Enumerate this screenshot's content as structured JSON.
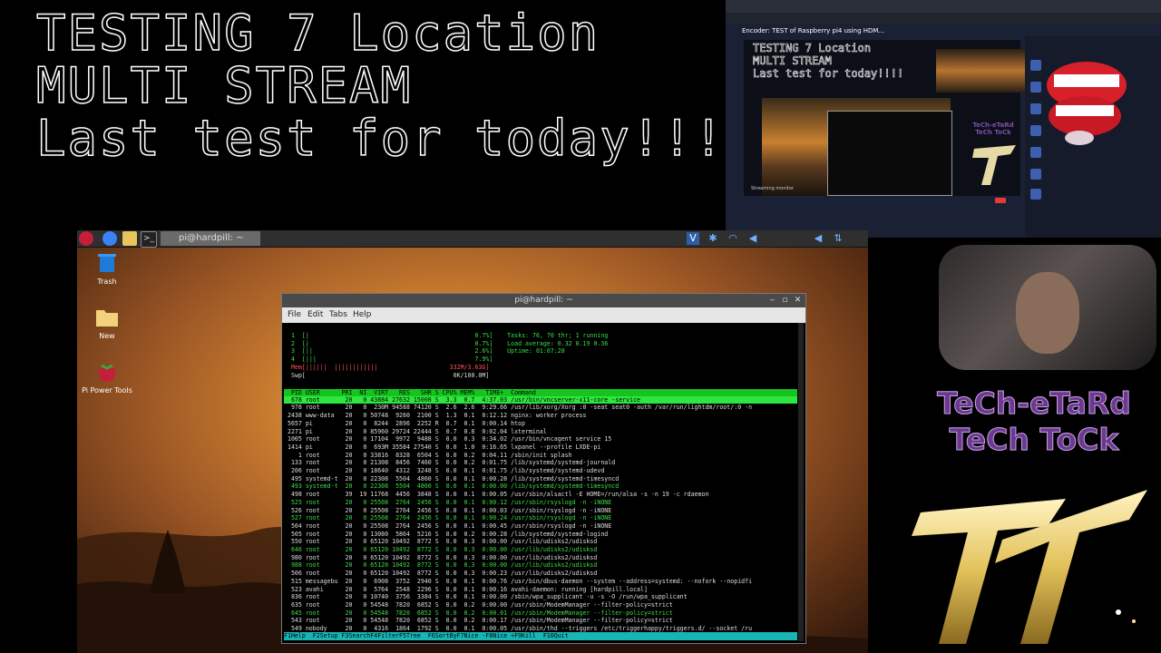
{
  "headline": {
    "line1": "TESTING 7 Location",
    "line2": "MULTI STREAM",
    "line3": "Last test for today!!!!"
  },
  "encoder": {
    "title": "Encoder: TEST of Raspberry pi4 using HDM...",
    "preview_text": "TESTING 7 Location\nMULTI STREAM\nLast test for today!!!!",
    "streaming_label": "Streaming monitor",
    "brand_small_1": "TeCh-eTaRd",
    "brand_small_2": "TeCh ToCk"
  },
  "taskbar": {
    "task_label": "pi@hardpill: ~"
  },
  "desktop_icons": [
    {
      "label": "Trash",
      "icon": "trash-icon"
    },
    {
      "label": "New",
      "icon": "folder-icon"
    },
    {
      "label": "Pi Power Tools",
      "icon": "raspberry-icon"
    }
  ],
  "terminal": {
    "title": "pi@hardpill: ~",
    "menu": [
      "File",
      "Edit",
      "Tabs",
      "Help"
    ],
    "cpu_lines": [
      "1  [|                                              0.7%]    Tasks: 76, 70 thr; 1 running",
      "2  [|                                              0.7%]    Load average: 0.32 0.19 0.36",
      "3  [||                                             2.6%]    Uptime: 01:07:28",
      "4  [|||                                            7.9%]",
      "Mem[||||||  ||||||||||||                    332M/3.63G]",
      "Swp[                                         0K/100.0M]"
    ],
    "proc_header": "  PID USER      PRI  NI  VIRT   RES   SHR S CPU% MEM%   TIME+  Command",
    "selected_row": "  678 root       20   0 43884 27632 15008 S  3.3  0.7  4:37.03 /usr/bin/vncserver-x11-core -service",
    "rows": [
      "  978 root       20   0  230M 94588 74120 S  2.6  2.6  9:29.66 /usr/lib/xorg/Xorg :0 -seat seat0 -auth /var/run/lightdm/root/:0 -n",
      " 2438 www-data   20   0 50748  9260  2100 S  1.3  0.1  0:12.12 nginx: worker process",
      " 5657 pi         20   0  8244  2896  2252 R  0.7  0.1  0:00.14 htop",
      " 2271 pi         20   0 85960 29724 22444 S  0.7  0.8  0:02.04 lxterminal",
      " 1005 root       20   0 17104  9972  9488 S  0.0  0.3  0:34.02 /usr/bin/vncagent service 15",
      " 1414 pi         20   0  693M 35584 27540 S  0.0  1.0  0:16.65 lxpanel --profile LXDE-pi",
      "    1 root       20   0 33816  8328  6504 S  0.0  0.2  0:04.11 /sbin/init splash",
      "  133 root       20   0 21308  8456  7460 S  0.0  0.2  0:01.75 /lib/systemd/systemd-journald",
      "  206 root       20   0 18640  4312  3248 S  0.0  0.1  0:01.75 /lib/systemd/systemd-udevd",
      "  495 systemd-t  20   0 22308  5504  4860 S  0.0  0.1  0:00.28 /lib/systemd/systemd-timesyncd",
      "  493 systemd-t  20   0 22308  5504  4860 S  0.0  0.1  0:00.00 /lib/systemd/systemd-timesyncd",
      "  498 root       39  19 11768  4456  3848 S  0.0  0.1  0:00.05 /usr/sbin/alsactl -E HOME=/run/alsa -s -n 19 -c rdaemon",
      "  525 root       20   0 25508  2764  2456 S  0.0  0.1  0:00.12 /usr/sbin/rsyslogd -n -iNONE",
      "  526 root       20   0 25508  2764  2456 S  0.0  0.1  0:00.03 /usr/sbin/rsyslogd -n -iNONE",
      "  527 root       20   0 25508  2764  2456 S  0.0  0.1  0:00.24 /usr/sbin/rsyslogd -n -iNONE",
      "  504 root       20   0 25508  2764  2456 S  0.0  0.1  0:00.45 /usr/sbin/rsyslogd -n -iNONE",
      "  505 root       20   0 13080  5864  5216 S  0.0  0.2  0:00.28 /lib/systemd/systemd-logind",
      "  550 root       20   0 65120 10492  8772 S  0.0  0.3  0:00.00 /usr/lib/udisks2/udisksd",
      "  646 root       20   0 65120 10492  8772 S  0.0  0.3  0:00.00 /usr/lib/udisks2/udisksd",
      "  980 root       20   0 65120 10492  8772 S  0.0  0.3  0:00.00 /usr/lib/udisks2/udisksd",
      "  988 root       20   0 65120 10492  8772 S  0.0  0.3  0:00.00 /usr/lib/udisks2/udisksd",
      "  506 root       20   0 65120 10492  8772 S  0.0  0.3  0:00.23 /usr/lib/udisks2/udisksd",
      "  515 messagebu  20   0  6908  3752  2940 S  0.0  0.1  0:00.76 /usr/bin/dbus-daemon --system --address=systemd: --nofork --nopidfi",
      "  523 avahi      20   0  5764  2548  2296 S  0.0  0.1  0:00.16 avahi-daemon: running [hardpill.local]",
      "  836 root       20   0 10740  3756  3384 S  0.0  0.1  0:00.00 /sbin/wpa_supplicant -u -s -O /run/wpa_supplicant",
      "  635 root       20   0 54548  7820  6852 S  0.0  0.2  0:00.00 /usr/sbin/ModemManager --filter-policy=strict",
      "  645 root       20   0 54548  7820  6852 S  0.0  0.2  0:00.01 /usr/sbin/ModemManager --filter-policy=strict",
      "  543 root       20   0 54548  7820  6852 S  0.0  0.2  0:00.17 /usr/sbin/ModemManager --filter-policy=strict",
      "  549 nobody     20   0  4316  1864  1792 S  0.0  0.1  0:00.05 /usr/sbin/thd --triggers /etc/triggerhappy/triggers.d/ --socket /ru"
    ],
    "fkeys": "F1Help  F2Setup F3SearchF4FilterF5Tree  F6SortByF7Nice -F8Nice +F9Kill  F10Quit"
  },
  "branding": {
    "line1": "TeCh-eTaRd",
    "line2": "TeCh ToCk"
  }
}
